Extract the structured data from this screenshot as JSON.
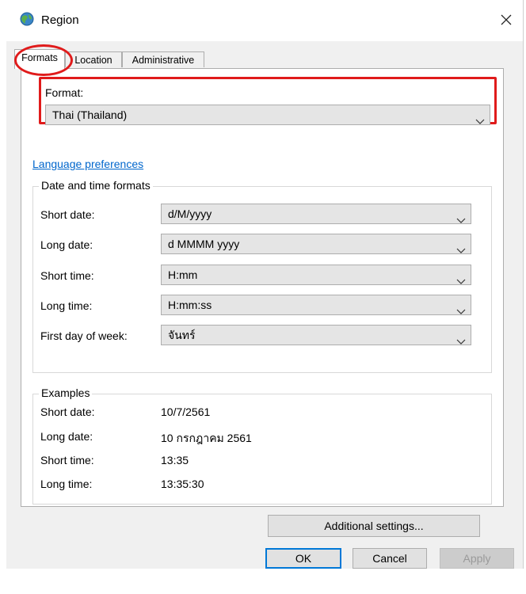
{
  "window": {
    "title": "Region"
  },
  "tabs": [
    {
      "label": "Formats"
    },
    {
      "label": "Location"
    },
    {
      "label": "Administrative"
    }
  ],
  "format": {
    "label": "Format:",
    "value": "Thai (Thailand)"
  },
  "language_link": "Language preferences",
  "datetime": {
    "group_title": "Date and time formats",
    "rows": [
      {
        "label": "Short date:",
        "value": "d/M/yyyy"
      },
      {
        "label": "Long date:",
        "value": "d MMMM yyyy"
      },
      {
        "label": "Short time:",
        "value": "H:mm"
      },
      {
        "label": "Long time:",
        "value": "H:mm:ss"
      },
      {
        "label": "First day of week:",
        "value": "จันทร์"
      }
    ]
  },
  "examples": {
    "group_title": "Examples",
    "rows": [
      {
        "label": "Short date:",
        "value": "10/7/2561"
      },
      {
        "label": "Long date:",
        "value": "10 กรกฎาคม 2561"
      },
      {
        "label": "Short time:",
        "value": "13:35"
      },
      {
        "label": "Long time:",
        "value": "13:35:30"
      }
    ]
  },
  "buttons": {
    "additional": "Additional settings...",
    "ok": "OK",
    "cancel": "Cancel",
    "apply": "Apply"
  },
  "colors": {
    "annotation": "#e01b1b",
    "link": "#0066cc",
    "accent": "#0078d7"
  },
  "icons": {
    "title": "globe-icon",
    "close": "close-icon",
    "dropdown": "chevron-down-icon"
  }
}
